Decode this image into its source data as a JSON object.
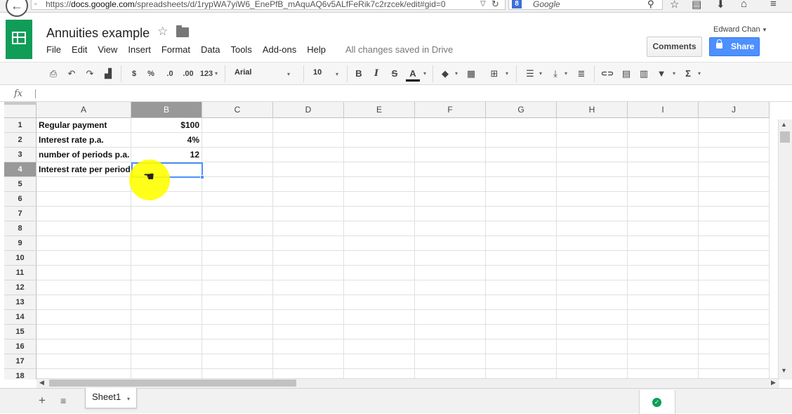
{
  "browser": {
    "url_prefix": "https://",
    "url_domain": "docs.google.com",
    "url_path": "/spreadsheets/d/1rypWA7yiW6_EnePfB_mAquAQ6v5ALfFeRik7c2rzcek/edit#gid=0",
    "search_engine": "Google",
    "search_logo_letter": "8",
    "back_glyph": "←",
    "reload_glyph": "↻",
    "dropdown_glyph": "▽",
    "search_glyph": "⚲",
    "bookmark_glyph": "☆",
    "reading_glyph": "▤",
    "download_glyph": "⬇",
    "home_glyph": "⌂",
    "menu_glyph": "≡"
  },
  "doc": {
    "title": "Annuities example",
    "star_glyph": "☆",
    "save_status": "All changes saved in Drive",
    "menus": [
      "File",
      "Edit",
      "View",
      "Insert",
      "Format",
      "Data",
      "Tools",
      "Add-ons",
      "Help"
    ],
    "user": "Edward Chan",
    "comments_label": "Comments",
    "share_label": "Share",
    "brand_color": "#0f9d58",
    "share_color": "#4d90fe"
  },
  "toolbar": {
    "print": "⎙",
    "undo": "↶",
    "redo": "↷",
    "paint_format": "▟",
    "currency": "$",
    "percent": "%",
    "dec_decrease": ".0",
    "dec_increase": ".00",
    "more_formats": "123",
    "font": "Arial",
    "size": "10",
    "bold": "B",
    "italic": "I",
    "strike": "S",
    "text_color": "A",
    "fill": "◆",
    "borders": "▦",
    "merge": "⊞",
    "align": "☰",
    "valign": "⤓",
    "wrap": "≣",
    "link": "⊂⊃",
    "comment": "▤",
    "chart": "▥",
    "filter": "▼",
    "functions": "Σ",
    "caret": "▾"
  },
  "formula_bar": {
    "fx": "fx",
    "content": ""
  },
  "grid": {
    "columns": [
      "A",
      "B",
      "C",
      "D",
      "E",
      "F",
      "G",
      "H",
      "I",
      "J"
    ],
    "rows": [
      "1",
      "2",
      "3",
      "4",
      "5",
      "6",
      "7",
      "8",
      "9",
      "10",
      "11",
      "12",
      "13",
      "14",
      "15",
      "16",
      "17",
      "18"
    ],
    "selected_column": "B",
    "selected_row": "4",
    "active_cell": "B4",
    "cells": [
      {
        "ref": "A1",
        "value": "Regular payment"
      },
      {
        "ref": "B1",
        "value": "$100"
      },
      {
        "ref": "A2",
        "value": "Interest rate p.a."
      },
      {
        "ref": "B2",
        "value": "4%"
      },
      {
        "ref": "A3",
        "value": "number of periods p.a."
      },
      {
        "ref": "B3",
        "value": "12"
      },
      {
        "ref": "A4",
        "value": "Interest rate per period"
      }
    ],
    "cursor_glyph": "☚"
  },
  "sheets": {
    "add_glyph": "+",
    "list_glyph": "≡",
    "tabs": [
      "Sheet1"
    ],
    "active": "Sheet1",
    "caret": "▾",
    "status_glyph": "✓"
  }
}
